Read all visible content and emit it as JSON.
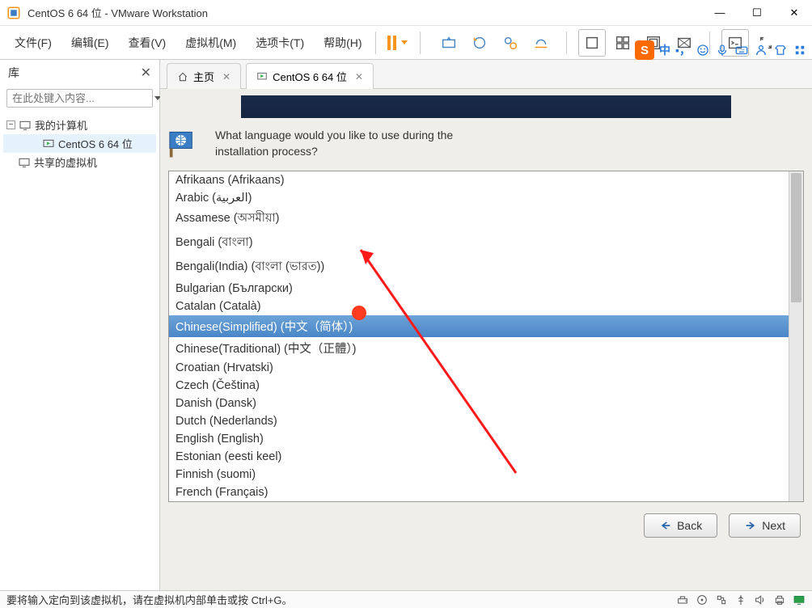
{
  "window": {
    "title": "CentOS 6 64 位 - VMware Workstation"
  },
  "menu": {
    "file": "文件(F)",
    "edit": "编辑(E)",
    "view": "查看(V)",
    "vm": "虚拟机(M)",
    "tabs": "选项卡(T)",
    "help": "帮助(H)"
  },
  "sidebar": {
    "header": "库",
    "search_placeholder": "在此处键入内容...",
    "tree": {
      "root": "我的计算机",
      "child": "CentOS 6 64 位",
      "shared": "共享的虚拟机"
    }
  },
  "tabs": {
    "home": "主页",
    "vm": "CentOS 6 64 位"
  },
  "ime": {
    "lang": "中",
    "punct": "▪，"
  },
  "installer": {
    "question_line1": "What language would you like to use during the",
    "question_line2": "installation process?",
    "languages": [
      "Afrikaans (Afrikaans)",
      "Arabic (العربية)",
      "Assamese (অসমীয়া)",
      "Bengali (বাংলা)",
      "Bengali(India) (বাংলা (ভারত))",
      "Bulgarian (Български)",
      "Catalan (Català)",
      "Chinese(Simplified) (中文（简体）)",
      "Chinese(Traditional) (中文（正體）)",
      "Croatian (Hrvatski)",
      "Czech (Čeština)",
      "Danish (Dansk)",
      "Dutch (Nederlands)",
      "English (English)",
      "Estonian (eesti keel)",
      "Finnish (suomi)",
      "French (Français)"
    ],
    "selected_index": 7,
    "back": "Back",
    "next": "Next"
  },
  "statusbar": {
    "text": "要将输入定向到该虚拟机，请在虚拟机内部单击或按 Ctrl+G。"
  }
}
